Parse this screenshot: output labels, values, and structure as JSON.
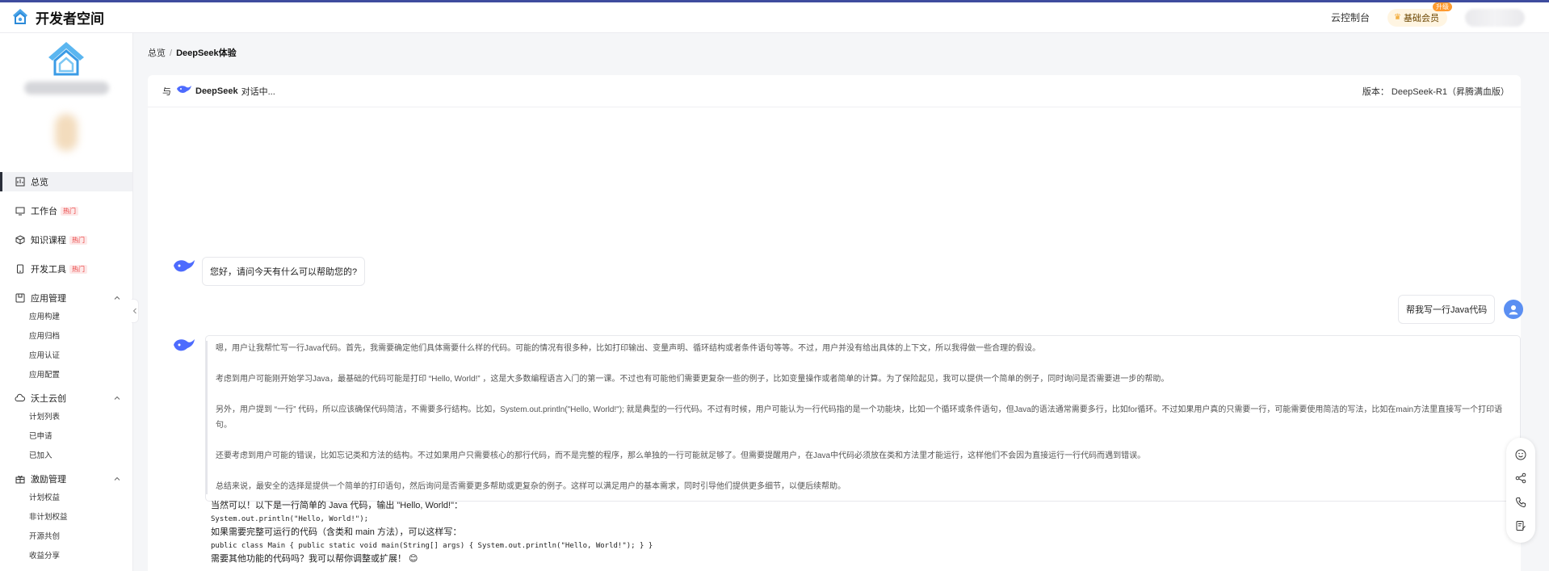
{
  "header": {
    "brand_title": "开发者空间",
    "console_link": "云控制台",
    "vip_label": "基础会员",
    "vip_badge": "升级"
  },
  "sidebar": {
    "nav": [
      {
        "label": "总览",
        "icon": "overview-icon",
        "active": true
      },
      {
        "label": "工作台",
        "icon": "workbench-icon",
        "hot": "热门"
      },
      {
        "label": "知识课程",
        "icon": "cube-icon",
        "hot": "热门"
      },
      {
        "label": "开发工具",
        "icon": "device-icon",
        "hot": "热门"
      }
    ],
    "groups": [
      {
        "label": "应用管理",
        "icon": "app-manage-icon",
        "items": [
          "应用构建",
          "应用归档",
          "应用认证",
          "应用配置"
        ]
      },
      {
        "label": "沃土云创",
        "icon": "cloud-icon",
        "items": [
          "计划列表",
          "已申请",
          "已加入"
        ]
      },
      {
        "label": "激励管理",
        "icon": "gift-icon",
        "items": [
          "计划权益",
          "非计划权益",
          "开源共创",
          "收益分享"
        ]
      }
    ]
  },
  "breadcrumb": {
    "root": "总览",
    "separator": "/",
    "current": "DeepSeek体验"
  },
  "chat_header": {
    "prefix": "与",
    "bot_name": "DeepSeek",
    "status": "对话中...",
    "version": "版本：  DeepSeek-R1（昇腾满血版）"
  },
  "messages": {
    "greeting": "您好，请问今天有什么可以帮助您的?",
    "user_request": "帮我写一行Java代码",
    "thinking": [
      "嗯，用户让我帮忙写一行Java代码。首先，我需要确定他们具体需要什么样的代码。可能的情况有很多种，比如打印输出、变量声明、循环结构或者条件语句等等。不过，用户并没有给出具体的上下文，所以我得做一些合理的假设。",
      "考虑到用户可能刚开始学习Java，最基础的代码可能是打印 “Hello, World!” ，这是大多数编程语言入门的第一课。不过也有可能他们需要更复杂一些的例子，比如变量操作或者简单的计算。为了保险起见，我可以提供一个简单的例子，同时询问是否需要进一步的帮助。",
      "另外，用户提到 “一行” 代码，所以应该确保代码简洁，不需要多行结构。比如，System.out.println(\"Hello, World!\"); 就是典型的一行代码。不过有时候，用户可能认为一行代码指的是一个功能块，比如一个循环或条件语句，但Java的语法通常需要多行，比如for循环。不过如果用户真的只需要一行，可能需要使用简洁的写法，比如在main方法里直接写一个打印语句。",
      "还要考虑到用户可能的错误，比如忘记类和方法的结构。不过如果用户只需要核心的那行代码，而不是完整的程序，那么单独的一行可能就足够了。但需要提醒用户，在Java中代码必须放在类和方法里才能运行，这样他们不会因为直接运行一行代码而遇到错误。",
      "总结来说，最安全的选择是提供一个简单的打印语句，然后询问是否需要更多帮助或更复杂的例子。这样可以满足用户的基本需求，同时引导他们提供更多细节，以便后续帮助。"
    ],
    "answer": {
      "intro": "当然可以！以下是一行简单的 Java 代码，输出 \"Hello, World!\"：",
      "code1": "System.out.println(\"Hello, World!\");",
      "mid": "如果需要完整可运行的代码（含类和 main 方法），可以这样写：",
      "code2": "public class Main { public static void main(String[] args) { System.out.println(\"Hello, World!\"); } }",
      "outro": "需要其他功能的代码吗？我可以帮你调整或扩展！ 😊"
    }
  },
  "floating_actions": [
    "smile-icon",
    "share-icon",
    "phone-icon",
    "edit-icon"
  ],
  "colors": {
    "accent": "#4d6bfe",
    "hot": "#e83b3b",
    "vip_bg": "#fff5e2"
  }
}
